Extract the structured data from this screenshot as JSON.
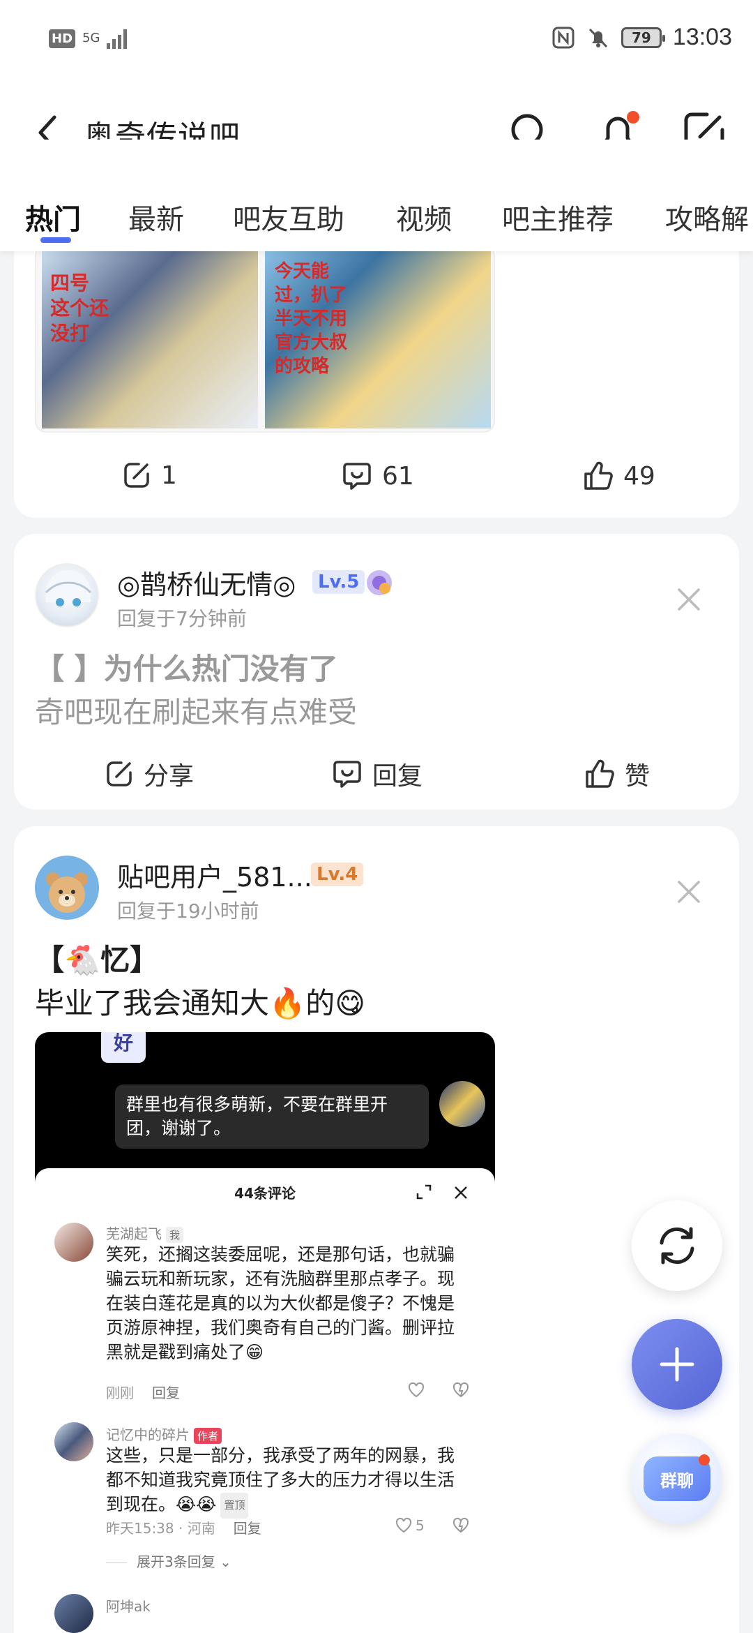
{
  "status_bar": {
    "hd": "HD",
    "network": "5G",
    "battery": "79",
    "time": "13:03"
  },
  "header": {
    "title": "奥奇传说吧"
  },
  "tabs": [
    {
      "label": "热门",
      "active": true
    },
    {
      "label": "最新"
    },
    {
      "label": "吧友互助"
    },
    {
      "label": "视频"
    },
    {
      "label": "吧主推荐"
    },
    {
      "label": "攻略解"
    }
  ],
  "post1": {
    "image_texts": [
      "四号",
      "这个还",
      "没打",
      "今天能",
      "过，扒了",
      "半天不用",
      "官方大叔",
      "的攻略"
    ],
    "share_count": "1",
    "comment_count": "61",
    "like_count": "49"
  },
  "post2": {
    "username": "◎鹊桥仙无情◎",
    "level": "Lv.5",
    "meta": "回复于7分钟前",
    "title": "【 】为什么热门没有了",
    "body": "奇吧现在刷起来有点难受",
    "share_label": "分享",
    "reply_label": "回复",
    "like_label": "赞"
  },
  "post3": {
    "username": "贴吧用户_581...",
    "level": "Lv.4",
    "meta": "回复于19小时前",
    "title": "【🐔忆】",
    "body": "毕业了我会通知大🔥的😋",
    "screenshot": {
      "top_bubble_fragment": "好",
      "bubble": "群里也有很多萌新，不要在群里开团，谢谢了。",
      "panel_title": "44条评论",
      "comments": [
        {
          "name": "芜湖起飞",
          "tag": "我",
          "text": "笑死，还搁这装委屈呢，还是那句话，也就骗骗云玩和新玩家，还有洗脑群里那点孝子。现在装白莲花是真的以为大伙都是傻子？不愧是页游原神捏，我们奥奇有自己的门酱。删评拉黑就是戳到痛处了😁",
          "time": "刚刚",
          "reply": "回复"
        },
        {
          "name": "记忆中的碎片",
          "tag": "作者",
          "text": "这些，只是一部分，我承受了两年的网暴，我都不知道我究竟顶住了多大的压力才得以生活到现在。😭😭",
          "pinned": "置顶",
          "time": "昨天15:38 · 河南",
          "reply": "回复",
          "likes": "5",
          "expand": "展开3条回复"
        },
        {
          "name": "阿坤ak"
        }
      ]
    }
  },
  "fab": {
    "group_chat": "群聊"
  },
  "colors": {
    "accent": "#4e6ef2",
    "notify_dot": "#f24e2c",
    "author_tag": "#e8455a"
  }
}
